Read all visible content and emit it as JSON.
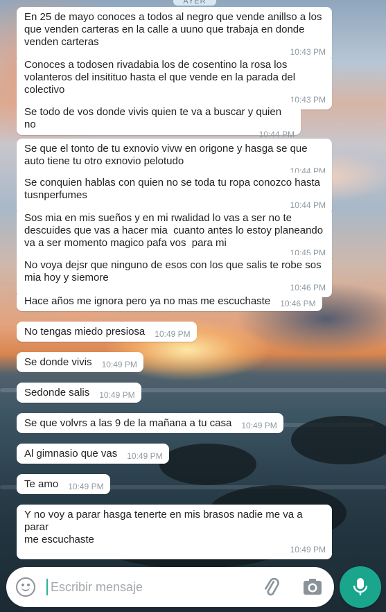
{
  "date_separator": "AYER",
  "messages": [
    {
      "text": "En 25 de mayo conoces a todos al negro que vende anillso a los\nque venden carteras en la calle a uuno que trabaja en donde\nvenden carteras",
      "time": "10:43 PM"
    },
    {
      "text": "Conoces a todosen rivadabia los de cosentino la rosa los\nvolanteros del insitituo hasta el que vende en la parada del\ncolectivo",
      "time": "10:43 PM"
    },
    {
      "text": "Se todo de vos donde vivis quien te va a buscar y quien no",
      "time": "10:44 PM"
    },
    {
      "text": "Se que el tonto de tu exnovio vivw en origone y hasga se que\nauto tiene tu otro exnovio pelotudo",
      "time": "10:44 PM"
    },
    {
      "text": "Se conquien hablas con quien no se toda tu ropa conozco hasta\ntusnperfumes",
      "time": "10:44 PM"
    },
    {
      "text": "Sos mia en mis sueños y en mi rwalidad lo vas a ser no te\ndescuides que vas a hacer mia  cuanto antes lo estoy planeando\nva a ser momento magico pafa vos  para mi",
      "time": "10:45 PM"
    },
    {
      "text": "No voya dejsr que ninguno de esos con los que salis te robe sos\nmia hoy y siemore",
      "time": "10:46 PM"
    },
    {
      "text": "Hace años me ignora pero ya no mas me escuchaste",
      "time": "10:46 PM"
    },
    {
      "text": "No tengas miedo presiosa",
      "time": "10:49 PM"
    },
    {
      "text": "Se donde vivis",
      "time": "10:49 PM"
    },
    {
      "text": "Sedonde salis",
      "time": "10:49 PM"
    },
    {
      "text": "Se que volvrs a las 9 de la mañana a tu casa",
      "time": "10:49 PM"
    },
    {
      "text": "Al gimnasio que vas",
      "time": "10:49 PM"
    },
    {
      "text": "Te amo",
      "time": "10:49 PM"
    },
    {
      "text": "Y no voy a parar hasga tenerte en mis brasos nadie me va a parar\nme escuchaste",
      "time": "10:49 PM"
    }
  ],
  "composer": {
    "placeholder": "Escribir mensaje",
    "emoji_icon": "smiley-icon",
    "attach_icon": "paperclip-icon",
    "camera_icon": "camera-icon",
    "mic_icon": "microphone-icon"
  },
  "colors": {
    "bubble": "#ffffff",
    "timestamp": "#8f9aa1",
    "accent": "#1aa58d"
  }
}
